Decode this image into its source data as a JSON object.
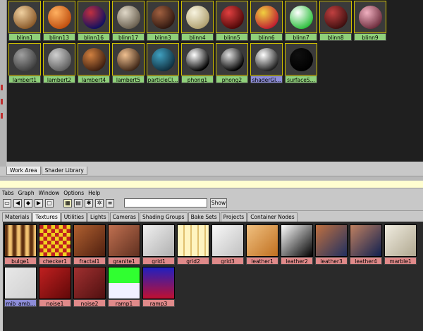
{
  "materials": [
    {
      "name": "blinn1",
      "c1": "#f0d0a0",
      "c2": "#8a5a2a"
    },
    {
      "name": "blinn13",
      "c1": "#ffb060",
      "c2": "#c05010"
    },
    {
      "name": "blinn16",
      "c1": "#c03040",
      "c2": "#101060"
    },
    {
      "name": "blinn17",
      "c1": "#e0d8c8",
      "c2": "#6a6050"
    },
    {
      "name": "blinn3",
      "c1": "#a06040",
      "c2": "#301810"
    },
    {
      "name": "blinn4",
      "c1": "#f8f4e0",
      "c2": "#b0a070"
    },
    {
      "name": "blinn5",
      "c1": "#e04040",
      "c2": "#500808"
    },
    {
      "name": "blinn6",
      "c1": "#f0d040",
      "c2": "#c02030"
    },
    {
      "name": "blinn7",
      "c1": "#ffffff",
      "c2": "#30c040"
    },
    {
      "name": "blinn8",
      "c1": "#c04040",
      "c2": "#401010"
    },
    {
      "name": "blinn9",
      "c1": "#f0b0c0",
      "c2": "#703040"
    },
    {
      "name": "lambert1",
      "c1": "#a0a0a0",
      "c2": "#404040"
    },
    {
      "name": "lambert2",
      "c1": "#d0d0d0",
      "c2": "#606060"
    },
    {
      "name": "lambert4",
      "c1": "#d08040",
      "c2": "#402010"
    },
    {
      "name": "lambert5",
      "c1": "#f0c090",
      "c2": "#402818"
    },
    {
      "name": "particleCl...",
      "c1": "#40a0c0",
      "c2": "#103040"
    },
    {
      "name": "phong1",
      "c1": "#ffffff",
      "c2": "#000000"
    },
    {
      "name": "phong2",
      "c1": "#e0e0e0",
      "c2": "#000000"
    },
    {
      "name": "shaderGl...",
      "c1": "#ffffff",
      "c2": "#202020"
    },
    {
      "name": "surfaceS...",
      "c1": "#101010",
      "c2": "#000000"
    }
  ],
  "work_tabs": [
    "Work Area",
    "Shader Library"
  ],
  "menu": [
    "Tabs",
    "Graph",
    "Window",
    "Options",
    "Help"
  ],
  "show_label": "Show",
  "search_value": "",
  "hyper_tabs": [
    "Materials",
    "Textures",
    "Utilities",
    "Lights",
    "Cameras",
    "Shading Groups",
    "Bake Sets",
    "Projects",
    "Container Nodes"
  ],
  "textures": [
    {
      "name": "bulge1",
      "c1": "#f0c070",
      "c2": "#603010"
    },
    {
      "name": "checker1",
      "c1": "#f0d020",
      "c2": "#c02020"
    },
    {
      "name": "fractal1",
      "c1": "#b06030",
      "c2": "#502010"
    },
    {
      "name": "granite1",
      "c1": "#c07050",
      "c2": "#603020"
    },
    {
      "name": "grid1",
      "c1": "#f0f0f0",
      "c2": "#b0b0b0"
    },
    {
      "name": "grid2",
      "c1": "#fff4c0",
      "c2": "#e0c070"
    },
    {
      "name": "grid3",
      "c1": "#f8f8f8",
      "c2": "#c0c0c0"
    },
    {
      "name": "leather1",
      "c1": "#f0c080",
      "c2": "#c07020"
    },
    {
      "name": "leather2",
      "c1": "#ffffff",
      "c2": "#000000"
    },
    {
      "name": "leather3",
      "c1": "#c07040",
      "c2": "#203060"
    },
    {
      "name": "leather4",
      "c1": "#c08060",
      "c2": "#102050"
    },
    {
      "name": "marble1",
      "c1": "#f0ece0",
      "c2": "#b0a890"
    },
    {
      "name": "mib_amb...",
      "c1": "#e8e8e8",
      "c2": "#d0d0d0"
    },
    {
      "name": "noise1",
      "c1": "#c02020",
      "c2": "#600808"
    },
    {
      "name": "noise2",
      "c1": "#a03030",
      "c2": "#501010"
    },
    {
      "name": "ramp1",
      "c1": "#30ff30",
      "c2": "#f0f0ff"
    },
    {
      "name": "ramp3",
      "c1": "#2020c0",
      "c2": "#c01030"
    }
  ]
}
